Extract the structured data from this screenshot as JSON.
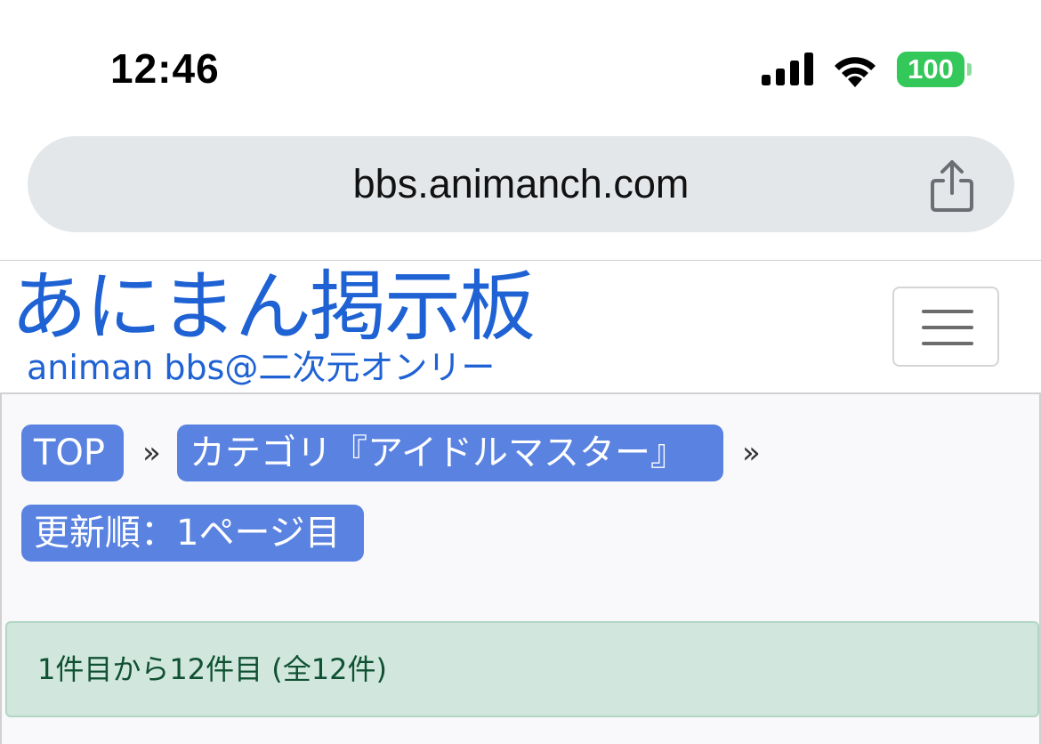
{
  "status_bar": {
    "time": "12:46",
    "battery_level": "100",
    "battery_color": "#34c759"
  },
  "browser": {
    "url": "bbs.animanch.com",
    "share_icon": "share-icon"
  },
  "site": {
    "logo_title": "あにまん掲示板",
    "logo_subtitle": "animan bbs@二次元オンリー",
    "brand_color": "#1f62d4",
    "menu_icon": "hamburger-icon"
  },
  "breadcrumb": {
    "items": [
      {
        "label": "TOP"
      },
      {
        "label": "カテゴリ『アイドルマスター』"
      },
      {
        "label": "更新順：1ページ目"
      }
    ],
    "separator": "»",
    "accent_color": "#5a82e0"
  },
  "results": {
    "summary": "1件目から12件目 (全12件)",
    "bg_color": "#d1e7dd",
    "text_color": "#0f5132"
  }
}
